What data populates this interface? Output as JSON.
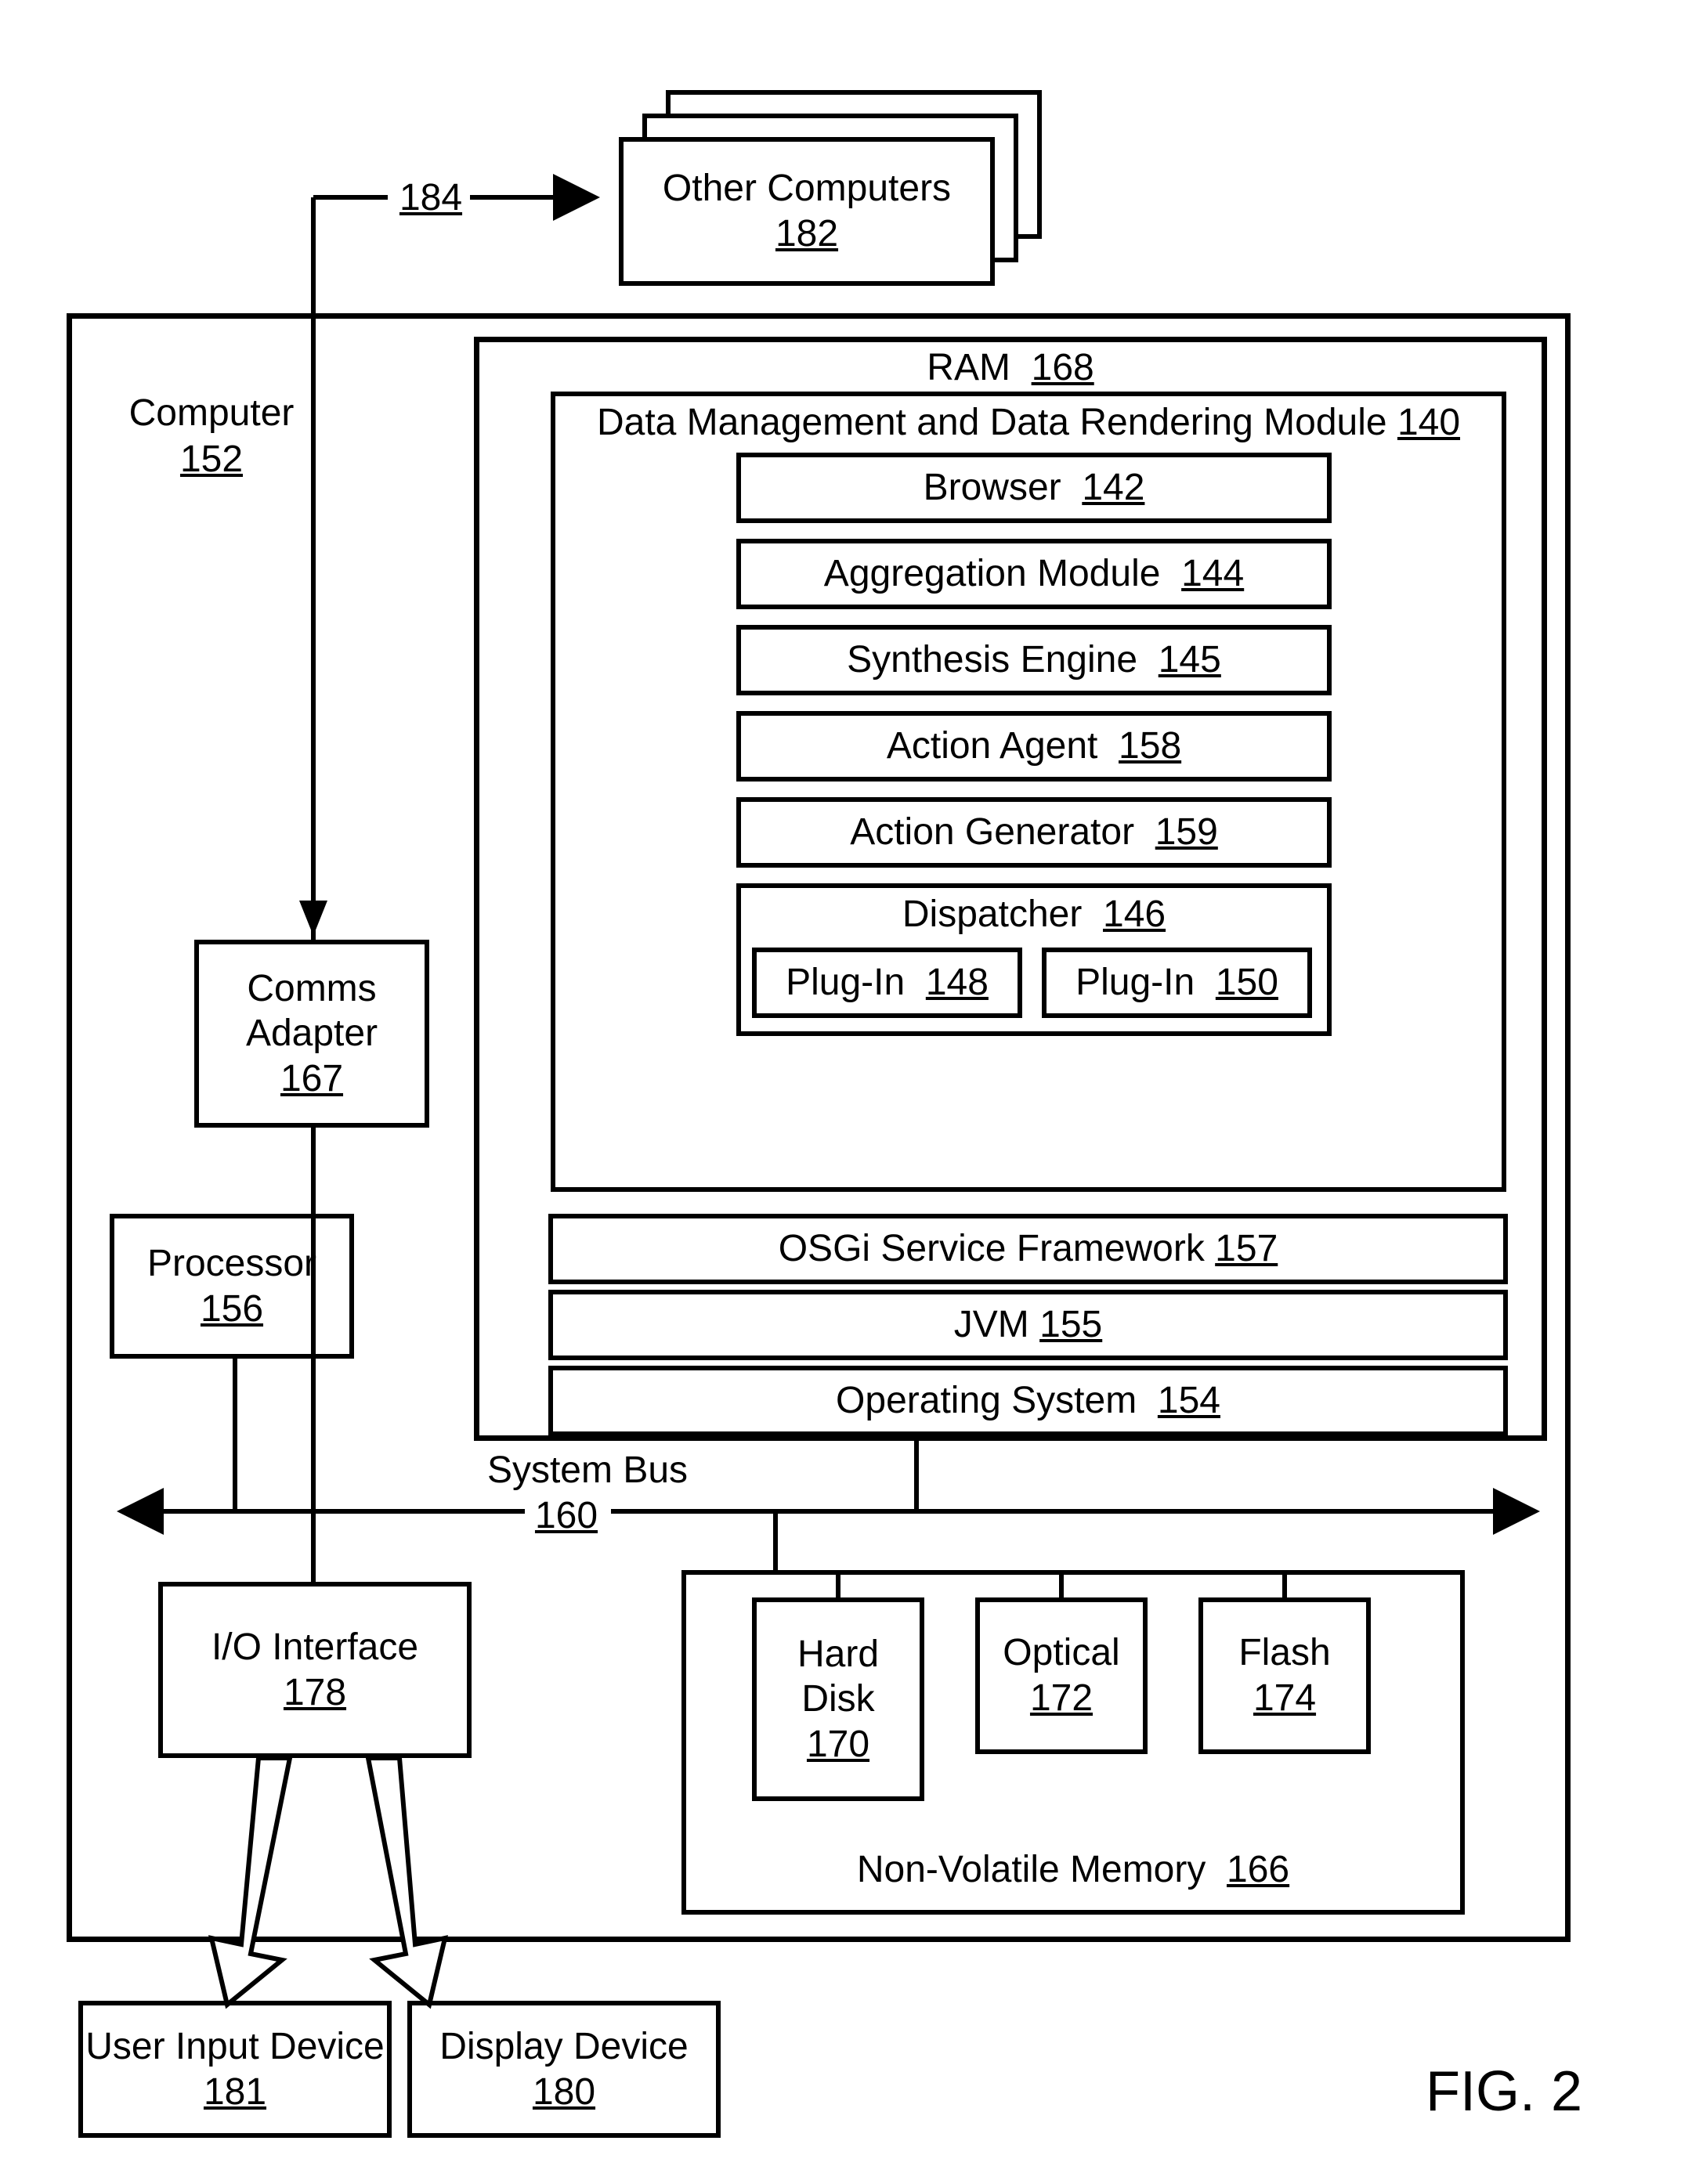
{
  "figure_label": "FIG. 2",
  "link184": "184",
  "other_computers": {
    "name": "Other Computers",
    "ref": "182"
  },
  "computer": {
    "name": "Computer",
    "ref": "152"
  },
  "ram": {
    "name": "RAM",
    "ref": "168"
  },
  "dmdr": {
    "name": "Data Management and Data Rendering Module",
    "ref": "140"
  },
  "browser": {
    "name": "Browser",
    "ref": "142"
  },
  "aggregation": {
    "name": "Aggregation Module",
    "ref": "144"
  },
  "synthesis": {
    "name": "Synthesis Engine",
    "ref": "145"
  },
  "action_agent": {
    "name": "Action Agent",
    "ref": "158"
  },
  "action_generator": {
    "name": "Action Generator",
    "ref": "159"
  },
  "dispatcher": {
    "name": "Dispatcher",
    "ref": "146"
  },
  "plugin1": {
    "name": "Plug-In",
    "ref": "148"
  },
  "plugin2": {
    "name": "Plug-In",
    "ref": "150"
  },
  "osgi": {
    "name": "OSGi Service Framework",
    "ref": "157"
  },
  "jvm": {
    "name": "JVM",
    "ref": "155"
  },
  "os": {
    "name": "Operating System",
    "ref": "154"
  },
  "comms": {
    "name1": "Comms",
    "name2": "Adapter",
    "ref": "167"
  },
  "processor": {
    "name": "Processor",
    "ref": "156"
  },
  "system_bus": {
    "name": "System Bus",
    "ref": "160"
  },
  "io_interface": {
    "name": "I/O Interface",
    "ref": "178"
  },
  "hard_disk": {
    "name1": "Hard",
    "name2": "Disk",
    "ref": "170"
  },
  "optical": {
    "name": "Optical",
    "ref": "172"
  },
  "flash": {
    "name": "Flash",
    "ref": "174"
  },
  "nvmem": {
    "name": "Non-Volatile Memory",
    "ref": "166"
  },
  "user_input": {
    "name": "User Input Device",
    "ref": "181"
  },
  "display_device": {
    "name": "Display Device",
    "ref": "180"
  }
}
